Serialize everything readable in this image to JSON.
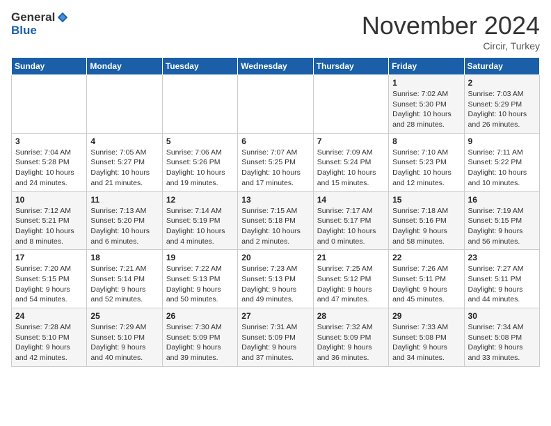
{
  "header": {
    "logo_general": "General",
    "logo_blue": "Blue",
    "month_title": "November 2024",
    "subtitle": "Circir, Turkey"
  },
  "days_of_week": [
    "Sunday",
    "Monday",
    "Tuesday",
    "Wednesday",
    "Thursday",
    "Friday",
    "Saturday"
  ],
  "weeks": [
    [
      {
        "day": "",
        "info": ""
      },
      {
        "day": "",
        "info": ""
      },
      {
        "day": "",
        "info": ""
      },
      {
        "day": "",
        "info": ""
      },
      {
        "day": "",
        "info": ""
      },
      {
        "day": "1",
        "info": "Sunrise: 7:02 AM\nSunset: 5:30 PM\nDaylight: 10 hours and 28 minutes."
      },
      {
        "day": "2",
        "info": "Sunrise: 7:03 AM\nSunset: 5:29 PM\nDaylight: 10 hours and 26 minutes."
      }
    ],
    [
      {
        "day": "3",
        "info": "Sunrise: 7:04 AM\nSunset: 5:28 PM\nDaylight: 10 hours and 24 minutes."
      },
      {
        "day": "4",
        "info": "Sunrise: 7:05 AM\nSunset: 5:27 PM\nDaylight: 10 hours and 21 minutes."
      },
      {
        "day": "5",
        "info": "Sunrise: 7:06 AM\nSunset: 5:26 PM\nDaylight: 10 hours and 19 minutes."
      },
      {
        "day": "6",
        "info": "Sunrise: 7:07 AM\nSunset: 5:25 PM\nDaylight: 10 hours and 17 minutes."
      },
      {
        "day": "7",
        "info": "Sunrise: 7:09 AM\nSunset: 5:24 PM\nDaylight: 10 hours and 15 minutes."
      },
      {
        "day": "8",
        "info": "Sunrise: 7:10 AM\nSunset: 5:23 PM\nDaylight: 10 hours and 12 minutes."
      },
      {
        "day": "9",
        "info": "Sunrise: 7:11 AM\nSunset: 5:22 PM\nDaylight: 10 hours and 10 minutes."
      }
    ],
    [
      {
        "day": "10",
        "info": "Sunrise: 7:12 AM\nSunset: 5:21 PM\nDaylight: 10 hours and 8 minutes."
      },
      {
        "day": "11",
        "info": "Sunrise: 7:13 AM\nSunset: 5:20 PM\nDaylight: 10 hours and 6 minutes."
      },
      {
        "day": "12",
        "info": "Sunrise: 7:14 AM\nSunset: 5:19 PM\nDaylight: 10 hours and 4 minutes."
      },
      {
        "day": "13",
        "info": "Sunrise: 7:15 AM\nSunset: 5:18 PM\nDaylight: 10 hours and 2 minutes."
      },
      {
        "day": "14",
        "info": "Sunrise: 7:17 AM\nSunset: 5:17 PM\nDaylight: 10 hours and 0 minutes."
      },
      {
        "day": "15",
        "info": "Sunrise: 7:18 AM\nSunset: 5:16 PM\nDaylight: 9 hours and 58 minutes."
      },
      {
        "day": "16",
        "info": "Sunrise: 7:19 AM\nSunset: 5:15 PM\nDaylight: 9 hours and 56 minutes."
      }
    ],
    [
      {
        "day": "17",
        "info": "Sunrise: 7:20 AM\nSunset: 5:15 PM\nDaylight: 9 hours and 54 minutes."
      },
      {
        "day": "18",
        "info": "Sunrise: 7:21 AM\nSunset: 5:14 PM\nDaylight: 9 hours and 52 minutes."
      },
      {
        "day": "19",
        "info": "Sunrise: 7:22 AM\nSunset: 5:13 PM\nDaylight: 9 hours and 50 minutes."
      },
      {
        "day": "20",
        "info": "Sunrise: 7:23 AM\nSunset: 5:13 PM\nDaylight: 9 hours and 49 minutes."
      },
      {
        "day": "21",
        "info": "Sunrise: 7:25 AM\nSunset: 5:12 PM\nDaylight: 9 hours and 47 minutes."
      },
      {
        "day": "22",
        "info": "Sunrise: 7:26 AM\nSunset: 5:11 PM\nDaylight: 9 hours and 45 minutes."
      },
      {
        "day": "23",
        "info": "Sunrise: 7:27 AM\nSunset: 5:11 PM\nDaylight: 9 hours and 44 minutes."
      }
    ],
    [
      {
        "day": "24",
        "info": "Sunrise: 7:28 AM\nSunset: 5:10 PM\nDaylight: 9 hours and 42 minutes."
      },
      {
        "day": "25",
        "info": "Sunrise: 7:29 AM\nSunset: 5:10 PM\nDaylight: 9 hours and 40 minutes."
      },
      {
        "day": "26",
        "info": "Sunrise: 7:30 AM\nSunset: 5:09 PM\nDaylight: 9 hours and 39 minutes."
      },
      {
        "day": "27",
        "info": "Sunrise: 7:31 AM\nSunset: 5:09 PM\nDaylight: 9 hours and 37 minutes."
      },
      {
        "day": "28",
        "info": "Sunrise: 7:32 AM\nSunset: 5:09 PM\nDaylight: 9 hours and 36 minutes."
      },
      {
        "day": "29",
        "info": "Sunrise: 7:33 AM\nSunset: 5:08 PM\nDaylight: 9 hours and 34 minutes."
      },
      {
        "day": "30",
        "info": "Sunrise: 7:34 AM\nSunset: 5:08 PM\nDaylight: 9 hours and 33 minutes."
      }
    ]
  ]
}
